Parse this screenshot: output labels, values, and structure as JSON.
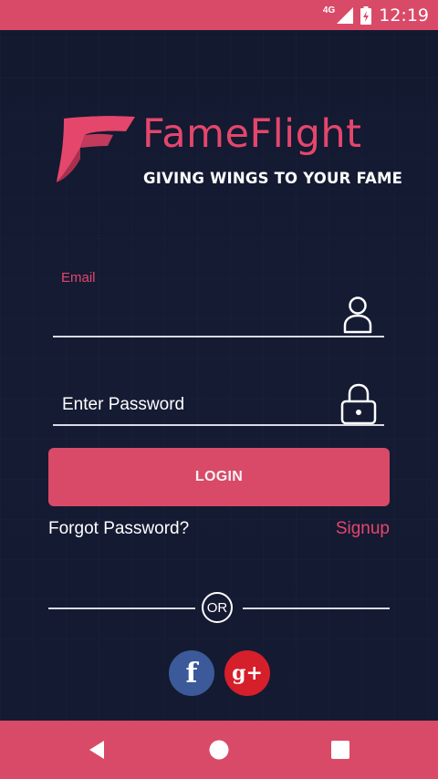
{
  "status_bar": {
    "network": "4G",
    "time": "12:19"
  },
  "brand": {
    "name": "FameFlight",
    "tagline": "GIVING WINGS TO YOUR FAME",
    "accent_color": "#e5466c"
  },
  "form": {
    "email_label": "Email",
    "email_value": "",
    "password_placeholder": "Enter Password",
    "login_label": "LOGIN",
    "forgot_label": "Forgot Password?",
    "signup_label": "Signup",
    "or_label": "OR"
  },
  "social": {
    "facebook_glyph": "f",
    "google_glyph": "g+",
    "facebook_color": "#3c5a99",
    "google_color": "#d51f2b"
  },
  "nav": {
    "icons": [
      "back-icon",
      "home-icon",
      "recents-icon"
    ]
  },
  "colors": {
    "background": "#141c33",
    "bar": "#d94a68"
  }
}
